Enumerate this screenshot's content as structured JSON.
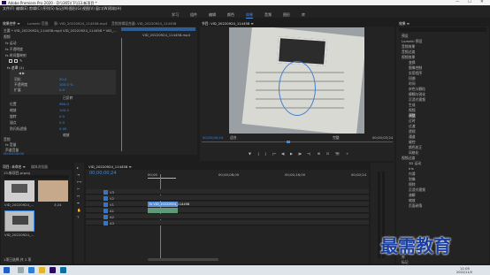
{
  "title": "Adobe Premiere Pro 2020 - D:\\\\365\\\\下\\\\13.新项目 *",
  "window_controls": [
    "—",
    "☐",
    "✕"
  ],
  "menu": [
    "文件(F)",
    "编辑(E)",
    "剪辑(C)",
    "序列(S)",
    "标记(M)",
    "图形(G)",
    "视图(V)",
    "窗口(W)",
    "帮助(H)"
  ],
  "workspaces": [
    "学习",
    "组件",
    "编辑",
    "颜色",
    "效果",
    "音频",
    "图形",
    "库"
  ],
  "active_workspace": "效果",
  "effect_controls": {
    "tabs": [
      "效果控件 ≡",
      "Lumetri 范围",
      "源: VID_20220924_114458.mp4",
      "音频剪辑混合器: VID_20220924_114458"
    ],
    "master": "主要 * VID_20220924_114458.mp4",
    "clip": "VID_20220924_114458 * VID_...",
    "clip_label": "VID_20220924_114458.mp4",
    "timecode": "00:00:00:00",
    "rows": [
      {
        "label": "视频",
        "value": ""
      },
      {
        "label": "fx 运动",
        "value": ""
      },
      {
        "label": "fx 不透明度",
        "value": ""
      },
      {
        "label": "fx 时间重映射",
        "value": ""
      },
      {
        "label": "fx 遮罩 (1)",
        "value": ""
      },
      {
        "label": "羽化",
        "value": "20.0"
      },
      {
        "label": "不透明度",
        "value": "100.0 %"
      },
      {
        "label": "扩展",
        "value": "0.0"
      },
      {
        "label": "",
        "value": "已反转"
      },
      {
        "label": "位置",
        "value": "960.0"
      },
      {
        "label": "缩放",
        "value": "100.0"
      },
      {
        "label": "旋转",
        "value": "0.0"
      },
      {
        "label": "锚点",
        "value": "0.0"
      },
      {
        "label": "防闪烁滤镜",
        "value": "0.00"
      },
      {
        "label": "",
        "value": "缩放"
      },
      {
        "label": "音频",
        "value": ""
      },
      {
        "label": "fx 音量",
        "value": ""
      },
      {
        "label": "声道音量",
        "value": ""
      }
    ]
  },
  "program": {
    "tab": "节目: VID_20220924_114458 ≡",
    "timecode": "00;00;00;24",
    "fit": "适合",
    "quality": "完整",
    "duration": "00;00;03;24",
    "controls": [
      "▼",
      "{",
      "}",
      "|←",
      "◀|",
      "▶",
      "|▶",
      "→|",
      "⊞",
      "⊡",
      "📷",
      "+"
    ]
  },
  "effects_panel": {
    "title": "效果 ≡",
    "items": [
      "预设",
      "Lumetri 预设",
      "音频效果",
      "音频过渡",
      "视频效果",
      "变换",
      "图像控制",
      "实用程序",
      "扭曲",
      "时间",
      "杂色与颗粒",
      "模糊与锐化",
      "沉浸式视频",
      "生成",
      "视频",
      "调整",
      "过时",
      "过渡",
      "透视",
      "通道",
      "键控",
      "颜色校正",
      "风格化",
      "视频过渡",
      "3D 运动",
      "Iris",
      "内滑",
      "划像",
      "擦除",
      "沉浸式视频",
      "溶解",
      "缩放",
      "页面剥落"
    ],
    "highlight": "调整",
    "footer": [
      "基本图形",
      "基本声音",
      "Lumetri 颜色",
      "库",
      "标记"
    ]
  },
  "project": {
    "tabs": [
      "项目: 未命名 ≡",
      "媒体浏览器"
    ],
    "name": "13.新项目.prproj",
    "count": "1项已选择,共 2 项",
    "items": [
      {
        "name": "VID_20220924_...",
        "dur": "2;14"
      },
      {
        "name": "VID_20220924_...",
        "dur": "3;24"
      }
    ]
  },
  "timeline": {
    "tab": "VID_20220924_114458 ≡",
    "timecode": "00;00;00;24",
    "ruler": [
      "00;00",
      "00;00;08;00",
      "00;00;16;00",
      "00;00;24"
    ],
    "tracks": [
      "V3",
      "V2",
      "V1",
      "A1",
      "A2",
      "A3"
    ],
    "clip_v": "fx VID_20220924_114458",
    "clip_a": ""
  },
  "taskbar": {
    "time": "11:05",
    "date": "2022/11/5"
  },
  "watermark": "最需教育"
}
